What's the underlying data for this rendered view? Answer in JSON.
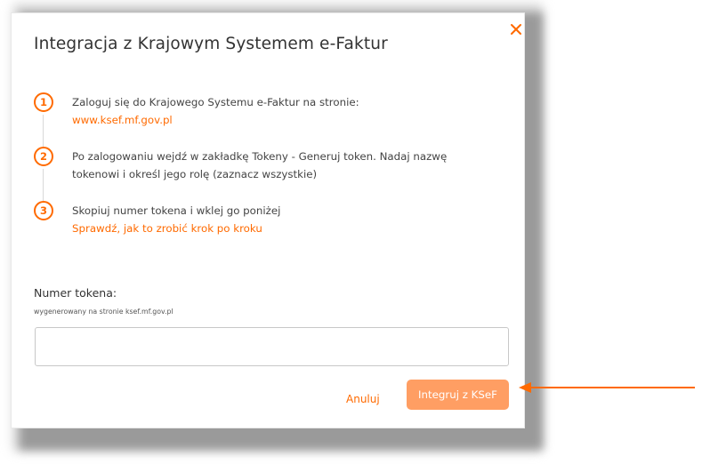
{
  "dialog": {
    "title": "Integracja z Krajowym Systemem e-Faktur",
    "close_icon": "close-icon"
  },
  "steps": [
    {
      "number": "1",
      "line1": "Zaloguj się do Krajowego Systemu e-Faktur na stronie:",
      "link": "www.ksef.mf.gov.pl"
    },
    {
      "number": "2",
      "line1": "Po zalogowaniu wejdź w zakładkę Tokeny - Generuj token. Nadaj nazwę",
      "line2": "tokenowi i określ jego rolę (zaznacz wszystkie)"
    },
    {
      "number": "3",
      "line1": "Skopiuj numer tokena i wklej go poniżej",
      "link": "Sprawdź, jak to zrobić krok po kroku"
    }
  ],
  "token_field": {
    "label": "Numer tokena:",
    "hint": "wygenerowany na stronie ksef.mf.gov.pl",
    "value": ""
  },
  "actions": {
    "cancel_label": "Anuluj",
    "submit_label": "Integruj z KSeF"
  },
  "colors": {
    "accent": "#ff6a00",
    "submit_bg": "#ff9e63",
    "arrow": "#ff6a00"
  }
}
